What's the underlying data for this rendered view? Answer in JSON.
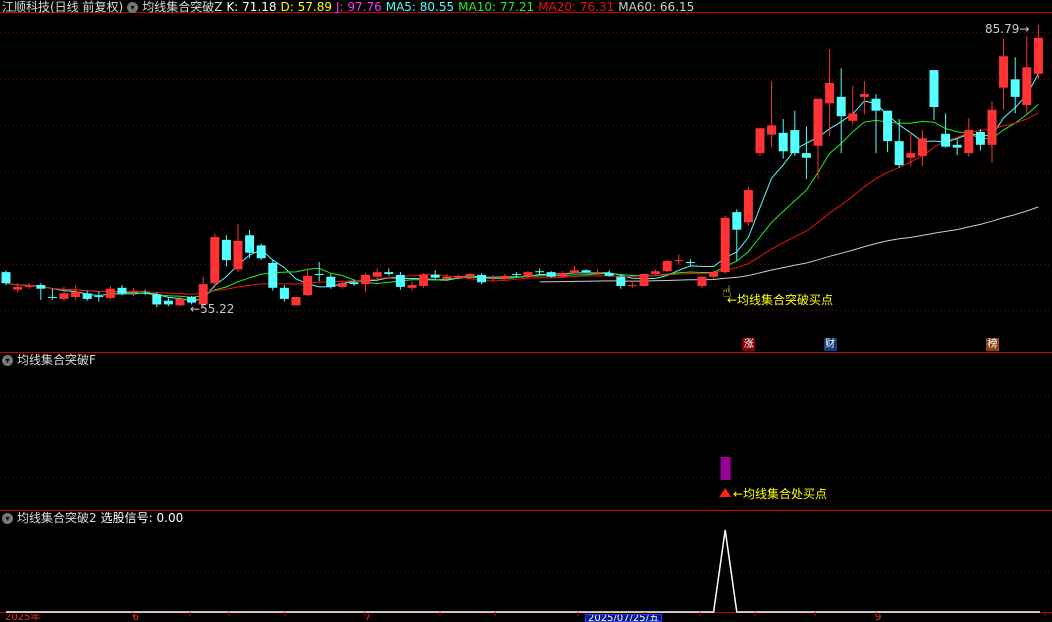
{
  "header": {
    "stock": "江顺科技(日线 前复权)",
    "indicator": "均线集合突破Z",
    "k": "K: 71.18",
    "d": "D: 57.89",
    "j": "J: 97.76",
    "ma5": "MA5: 80.55",
    "ma10": "MA10: 77.21",
    "ma20": "MA20: 76.31",
    "ma60": "MA60: 66.15"
  },
  "colors": {
    "up": "#ff3333",
    "down": "#54ffff",
    "ma5": "#54ffff",
    "ma10": "#22ee22",
    "ma20": "#ee1111",
    "ma60": "#cccccc",
    "k": "#ffffff",
    "d": "#ffff00",
    "j": "#ff33ff",
    "grid": "#8b0000",
    "frame": "#cc0000",
    "annotation": "#ffff00",
    "signal_bar": "#990099"
  },
  "main": {
    "high_label": "85.79",
    "low_label": "55.22",
    "buy_label": "←均线集合突破买点",
    "badges": [
      {
        "text": "涨",
        "color": "#8b0000",
        "index": 64
      },
      {
        "text": "财",
        "color": "#123c78",
        "index": 71
      },
      {
        "text": "榜",
        "color": "#8b4513",
        "index": 85
      }
    ]
  },
  "panel2": {
    "title": "均线集合突破F",
    "buy_label": "←均线集合处买点",
    "signal_index": 62
  },
  "panel3": {
    "title": "均线集合突破2",
    "value_label": "选股信号: 0.00",
    "signals": {
      "62": 1
    }
  },
  "axis": {
    "labels": [
      {
        "text": "2025年",
        "index": 0
      },
      {
        "text": "6",
        "index": 11
      },
      {
        "text": "7",
        "index": 31
      },
      {
        "text": "2025/07/25/五",
        "index": 50,
        "highlight": true
      },
      {
        "text": "9",
        "index": 75
      }
    ]
  },
  "chart_data": {
    "type": "candlestick",
    "ylim": [
      55.22,
      85.79
    ],
    "ohlc": [
      [
        59.0,
        57.8,
        59.2,
        57.6
      ],
      [
        57.1,
        57.4,
        57.8,
        56.8
      ],
      [
        57.4,
        57.5,
        57.8,
        57.2
      ],
      [
        57.6,
        57.2,
        57.8,
        56.0
      ],
      [
        56.3,
        56.2,
        57.2,
        56.0
      ],
      [
        56.1,
        56.7,
        57.4,
        55.9
      ],
      [
        56.3,
        56.9,
        57.6,
        56.0
      ],
      [
        56.7,
        56.1,
        57.0,
        55.9
      ],
      [
        56.4,
        56.3,
        56.9,
        55.8
      ],
      [
        56.2,
        57.2,
        57.5,
        56.0
      ],
      [
        57.3,
        56.7,
        57.6,
        56.5
      ],
      [
        56.8,
        56.9,
        57.3,
        56.4
      ],
      [
        56.8,
        56.7,
        57.1,
        56.5
      ],
      [
        56.6,
        55.5,
        56.8,
        55.2
      ],
      [
        55.9,
        55.5,
        56.2,
        55.3
      ],
      [
        55.4,
        56.1,
        56.3,
        55.3
      ],
      [
        56.3,
        55.7,
        56.4,
        55.5
      ],
      [
        55.5,
        57.7,
        58.5,
        55.22
      ],
      [
        57.8,
        62.8,
        63.2,
        57.3
      ],
      [
        62.5,
        60.3,
        63.0,
        59.6
      ],
      [
        59.3,
        62.4,
        64.2,
        59.0
      ],
      [
        63.0,
        61.1,
        63.6,
        60.5
      ],
      [
        61.9,
        60.5,
        62.1,
        60.3
      ],
      [
        60.0,
        57.3,
        60.4,
        57.0
      ],
      [
        57.3,
        56.1,
        57.6,
        55.8
      ],
      [
        55.4,
        56.3,
        56.3,
        55.4
      ],
      [
        56.5,
        58.6,
        59.3,
        56.4
      ],
      [
        58.8,
        58.7,
        60.1,
        58.0
      ],
      [
        58.5,
        57.4,
        58.8,
        57.2
      ],
      [
        57.4,
        57.8,
        58.0,
        57.2
      ],
      [
        57.9,
        57.7,
        58.1,
        57.5
      ],
      [
        57.7,
        58.7,
        58.9,
        56.8
      ],
      [
        58.5,
        59.0,
        59.4,
        58.3
      ],
      [
        59.0,
        58.8,
        59.4,
        58.6
      ],
      [
        58.7,
        57.4,
        59.0,
        57.1
      ],
      [
        57.3,
        57.6,
        58.0,
        57.0
      ],
      [
        57.5,
        58.7,
        58.9,
        57.3
      ],
      [
        58.7,
        58.4,
        59.2,
        58.2
      ],
      [
        58.3,
        58.5,
        58.8,
        58.0
      ],
      [
        58.4,
        58.6,
        58.7,
        58.2
      ],
      [
        58.5,
        58.8,
        58.9,
        58.4
      ],
      [
        58.7,
        57.9,
        58.9,
        57.7
      ],
      [
        58.3,
        58.4,
        58.7,
        58.0
      ],
      [
        58.3,
        58.6,
        58.8,
        58.2
      ],
      [
        58.8,
        58.7,
        59.0,
        58.5
      ],
      [
        58.5,
        59.0,
        59.1,
        58.4
      ],
      [
        59.1,
        59.0,
        59.4,
        58.7
      ],
      [
        59.0,
        58.5,
        59.1,
        58.4
      ],
      [
        58.5,
        58.9,
        59.1,
        58.4
      ],
      [
        58.9,
        59.2,
        59.7,
        58.8
      ],
      [
        59.2,
        59.0,
        59.3,
        58.9
      ],
      [
        58.9,
        59.0,
        59.3,
        58.7
      ],
      [
        58.9,
        58.6,
        59.2,
        58.5
      ],
      [
        58.5,
        57.5,
        58.7,
        57.2
      ],
      [
        57.6,
        57.6,
        57.9,
        57.3
      ],
      [
        57.5,
        58.8,
        58.9,
        57.4
      ],
      [
        58.8,
        59.1,
        59.3,
        58.7
      ],
      [
        59.1,
        60.2,
        60.3,
        59.0
      ],
      [
        60.3,
        60.3,
        60.9,
        59.8
      ],
      [
        60.1,
        60.0,
        60.4,
        59.6
      ],
      [
        57.5,
        58.5,
        58.6,
        57.3
      ],
      [
        58.5,
        59.0,
        59.2,
        58.3
      ],
      [
        59.0,
        64.9,
        65.1,
        58.8
      ],
      [
        65.5,
        63.6,
        65.8,
        60.2
      ],
      [
        64.4,
        67.9,
        68.2,
        64.0
      ],
      [
        71.9,
        74.6,
        74.6,
        71.6
      ],
      [
        73.9,
        74.9,
        79.7,
        72.6
      ],
      [
        74.1,
        72.1,
        75.6,
        71.3
      ],
      [
        74.4,
        71.9,
        76.5,
        71.6
      ],
      [
        71.9,
        71.4,
        74.8,
        69.1
      ],
      [
        72.7,
        77.8,
        77.8,
        69.1
      ],
      [
        77.3,
        79.5,
        83.2,
        73.7
      ],
      [
        78.0,
        75.9,
        81.1,
        71.9
      ],
      [
        75.4,
        76.2,
        79.2,
        75.0
      ],
      [
        78.0,
        78.3,
        79.7,
        76.1
      ],
      [
        77.8,
        76.5,
        78.3,
        71.9
      ],
      [
        76.5,
        73.2,
        76.5,
        72.0
      ],
      [
        73.2,
        70.6,
        75.6,
        70.3
      ],
      [
        71.4,
        71.9,
        74.2,
        70.5
      ],
      [
        71.6,
        73.5,
        74.4,
        70.5
      ],
      [
        80.9,
        76.9,
        80.9,
        75.5
      ],
      [
        74.0,
        72.6,
        76.2,
        72.5
      ],
      [
        72.8,
        72.5,
        73.4,
        71.7
      ],
      [
        71.9,
        74.4,
        75.7,
        71.5
      ],
      [
        74.2,
        72.8,
        74.5,
        72.2
      ],
      [
        72.8,
        76.6,
        77.5,
        70.9
      ],
      [
        79.0,
        82.4,
        84.3,
        76.6
      ],
      [
        79.9,
        78.0,
        82.3,
        76.2
      ],
      [
        77.1,
        81.2,
        84.6,
        76.2
      ],
      [
        80.5,
        84.4,
        85.79,
        79.9
      ]
    ],
    "ma_periods": [
      5,
      10,
      20,
      60
    ],
    "ma60_start_index": 46
  }
}
